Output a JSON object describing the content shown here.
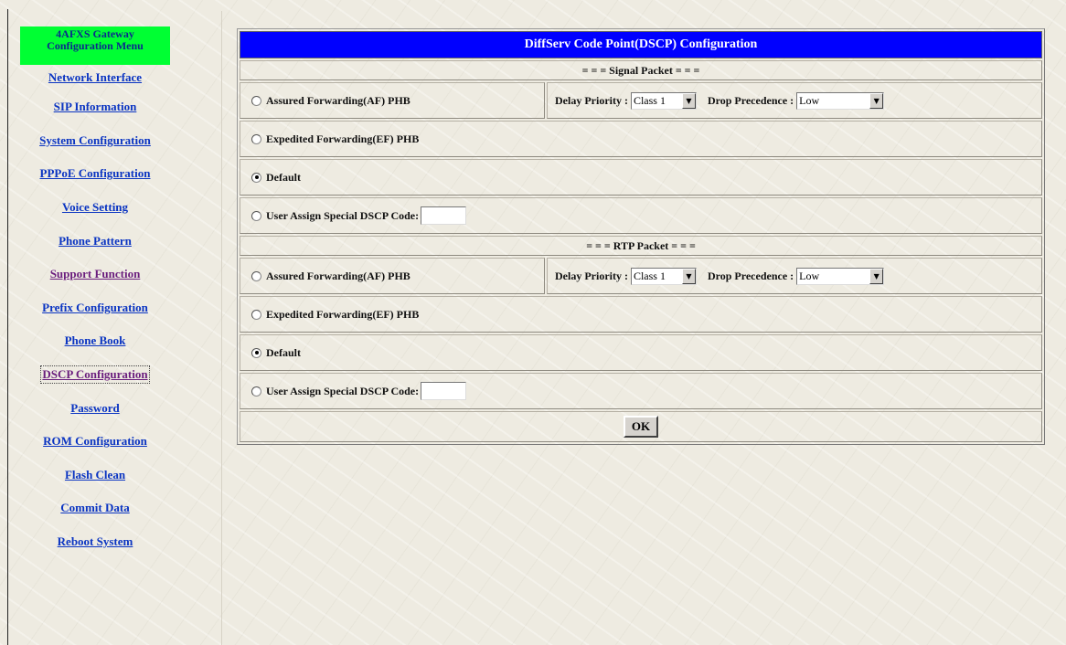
{
  "sidebar": {
    "title_line1": "4AFXS Gateway",
    "title_line2": "Configuration Menu",
    "items": [
      {
        "label": "Network Interface"
      },
      {
        "label": "SIP Information"
      },
      {
        "label": "System Configuration"
      },
      {
        "label": "PPPoE Configuration"
      },
      {
        "label": "Voice Setting"
      },
      {
        "label": "Phone Pattern"
      },
      {
        "label": "Support Function"
      },
      {
        "label": "Prefix Configuration"
      },
      {
        "label": "Phone Book"
      },
      {
        "label": "DSCP Configuration"
      },
      {
        "label": "Password"
      },
      {
        "label": "ROM Configuration"
      },
      {
        "label": "Flash Clean"
      },
      {
        "label": "Commit Data"
      },
      {
        "label": "Reboot System"
      }
    ]
  },
  "form": {
    "title": "DiffServ Code Point(DSCP) Configuration",
    "signal": {
      "header": "= = = Signal Packet = = =",
      "af_label": "Assured Forwarding(AF) PHB",
      "delay_label": "Delay Priority :",
      "delay_value": "Class 1",
      "drop_label": "Drop Precedence :",
      "drop_value": "Low",
      "ef_label": "Expedited Forwarding(EF) PHB",
      "default_label": "Default",
      "user_label": "User Assign Special DSCP Code:",
      "user_value": "",
      "selected": "Default"
    },
    "rtp": {
      "header": "= = = RTP Packet = = =",
      "af_label": "Assured Forwarding(AF) PHB",
      "delay_label": "Delay Priority :",
      "delay_value": "Class 1",
      "drop_label": "Drop Precedence :",
      "drop_value": "Low",
      "ef_label": "Expedited Forwarding(EF) PHB",
      "default_label": "Default",
      "user_label": "User Assign Special DSCP Code:",
      "user_value": "",
      "selected": "Default"
    },
    "ok_label": "OK"
  },
  "colors": {
    "title_bar": "#0000ff",
    "menu_header": "#00ff33",
    "link": "#0a34c2",
    "visited_link": "#6a1d7d"
  }
}
